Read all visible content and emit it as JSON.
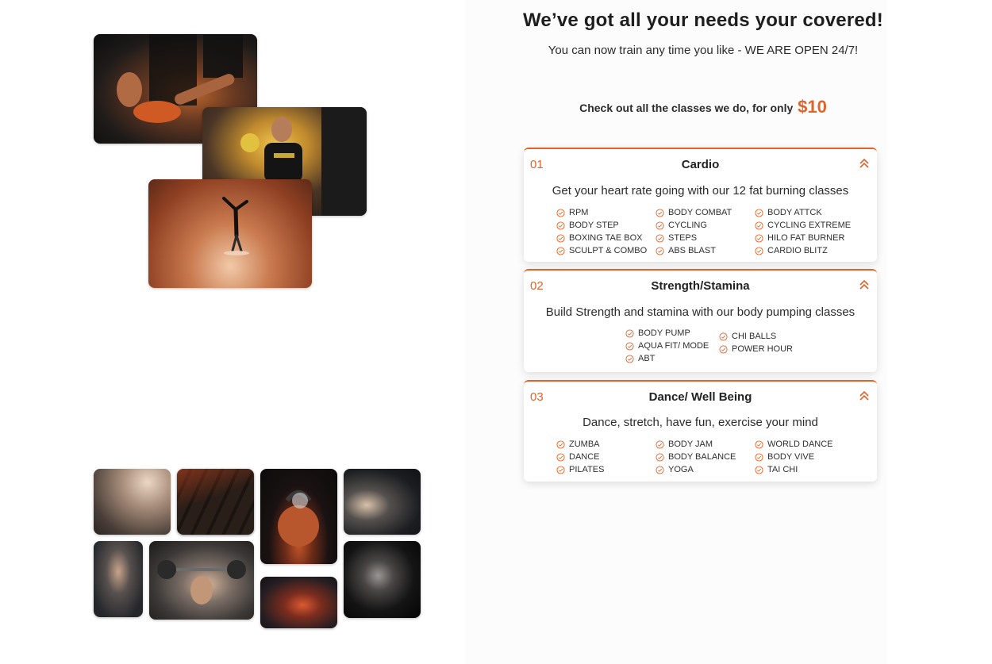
{
  "heading": "We’ve got all your needs your covered!",
  "subheading": "You can now train any time you like - WE ARE OPEN 24/7!",
  "offer": {
    "text": "Check out all the classes we do, for only",
    "price": "$10"
  },
  "accent_color": "#e0632a",
  "categories": [
    {
      "number": "01",
      "title": "Cardio",
      "description": "Get your heart rate going with our 12 fat burning classes",
      "columns": [
        [
          "RPM",
          "BODY STEP",
          "BOXING TAE BOX",
          "SCULPT & COMBO"
        ],
        [
          "BODY COMBAT",
          "CYCLING",
          "STEPS",
          "ABS BLAST"
        ],
        [
          "BODY ATTCK",
          "CYCLING EXTREME",
          "HILO FAT BURNER",
          "CARDIO BLITZ"
        ]
      ]
    },
    {
      "number": "02",
      "title": "Strength/Stamina",
      "description": "Build Strength and stamina with our body pumping classes",
      "columns": [
        [
          "BODY PUMP",
          "AQUA FIT/ MODE",
          "ABT"
        ],
        [
          "CHI BALLS",
          "POWER HOUR"
        ]
      ]
    },
    {
      "number": "03",
      "title": "Dance/ Well Being",
      "description": "Dance, stretch, have fun, exercise your mind",
      "columns": [
        [
          "ZUMBA",
          "DANCE",
          "PILATES"
        ],
        [
          "BODY JAM",
          "BODY BALANCE",
          "YOGA"
        ],
        [
          "WORLD DANCE",
          "BODY VIVE",
          "TAI CHI"
        ]
      ]
    }
  ]
}
